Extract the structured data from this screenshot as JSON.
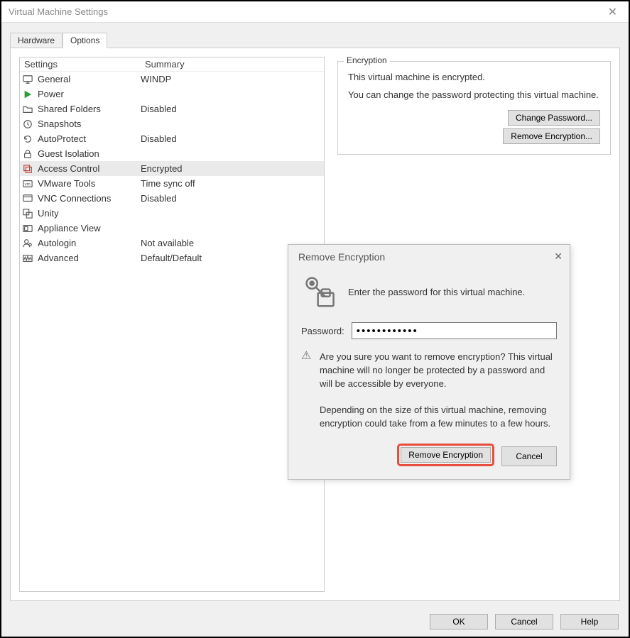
{
  "window": {
    "title": "Virtual Machine Settings"
  },
  "tabs": {
    "hardware": "Hardware",
    "options": "Options"
  },
  "listHeaders": {
    "settings": "Settings",
    "summary": "Summary"
  },
  "items": [
    {
      "label": "General",
      "summary": "WINDP"
    },
    {
      "label": "Power",
      "summary": ""
    },
    {
      "label": "Shared Folders",
      "summary": "Disabled"
    },
    {
      "label": "Snapshots",
      "summary": ""
    },
    {
      "label": "AutoProtect",
      "summary": "Disabled"
    },
    {
      "label": "Guest Isolation",
      "summary": ""
    },
    {
      "label": "Access Control",
      "summary": "Encrypted"
    },
    {
      "label": "VMware Tools",
      "summary": "Time sync off"
    },
    {
      "label": "VNC Connections",
      "summary": "Disabled"
    },
    {
      "label": "Unity",
      "summary": ""
    },
    {
      "label": "Appliance View",
      "summary": ""
    },
    {
      "label": "Autologin",
      "summary": "Not available"
    },
    {
      "label": "Advanced",
      "summary": "Default/Default"
    }
  ],
  "encryption": {
    "legend": "Encryption",
    "line1": "This virtual machine is encrypted.",
    "line2": "You can change the password protecting this virtual machine.",
    "changePwd": "Change Password...",
    "removeEnc": "Remove Encryption..."
  },
  "bottom": {
    "ok": "OK",
    "cancel": "Cancel",
    "help": "Help"
  },
  "dialog": {
    "title": "Remove Encryption",
    "prompt": "Enter the password for this virtual machine.",
    "pwLabel": "Password:",
    "pwValue": "••••••••••••",
    "warn1": "Are you sure you want to remove encryption? This virtual machine will no longer be protected by a password and will be accessible by everyone.",
    "warn2": "Depending on the size of this virtual machine, removing encryption could take from a few minutes to a few hours.",
    "removeBtn": "Remove Encryption",
    "cancelBtn": "Cancel"
  }
}
